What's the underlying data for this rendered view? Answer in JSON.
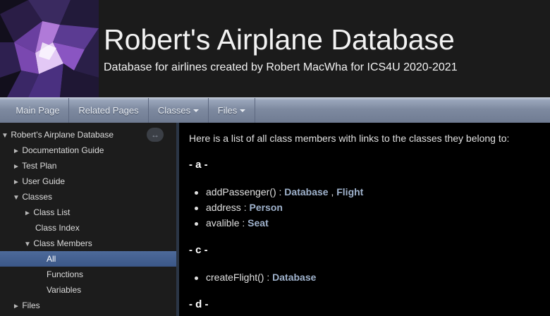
{
  "header": {
    "title": "Robert's Airplane Database",
    "subtitle": "Database for airlines created by Robert MacWha for ICS4U 2020-2021"
  },
  "navbar": {
    "items": [
      {
        "label": "Main Page"
      },
      {
        "label": "Related Pages"
      },
      {
        "label": "Classes"
      },
      {
        "label": "Files"
      }
    ]
  },
  "sidebar": {
    "sync_icon": "↔",
    "items": [
      {
        "label": "Robert's Airplane Database",
        "arrow": "▼"
      },
      {
        "label": "Documentation Guide",
        "arrow": "►"
      },
      {
        "label": "Test Plan",
        "arrow": "►"
      },
      {
        "label": "User Guide",
        "arrow": "►"
      },
      {
        "label": "Classes",
        "arrow": "▼"
      },
      {
        "label": "Class List",
        "arrow": "►"
      },
      {
        "label": "Class Index",
        "arrow": ""
      },
      {
        "label": "Class Members",
        "arrow": "▼"
      },
      {
        "label": "All",
        "arrow": ""
      },
      {
        "label": "Functions",
        "arrow": ""
      },
      {
        "label": "Variables",
        "arrow": ""
      },
      {
        "label": "Files",
        "arrow": "►"
      }
    ]
  },
  "content": {
    "intro": "Here is a list of all class members with links to the classes they belong to:",
    "sections": [
      {
        "heading": "- a -",
        "members": [
          {
            "name": "addPassenger() : ",
            "class1": "Database",
            "sep": " , ",
            "class2": "Flight"
          },
          {
            "name": "address : ",
            "class1": "Person"
          },
          {
            "name": "avalible : ",
            "class1": "Seat"
          }
        ]
      },
      {
        "heading": "- c -",
        "members": [
          {
            "name": "createFlight() : ",
            "class1": "Database"
          }
        ]
      },
      {
        "heading": "- d -"
      }
    ]
  },
  "colors": {
    "nav_gradient": "#7e8aa0",
    "selected": "#4d6a9a",
    "class_link": "#9fb2cc"
  }
}
